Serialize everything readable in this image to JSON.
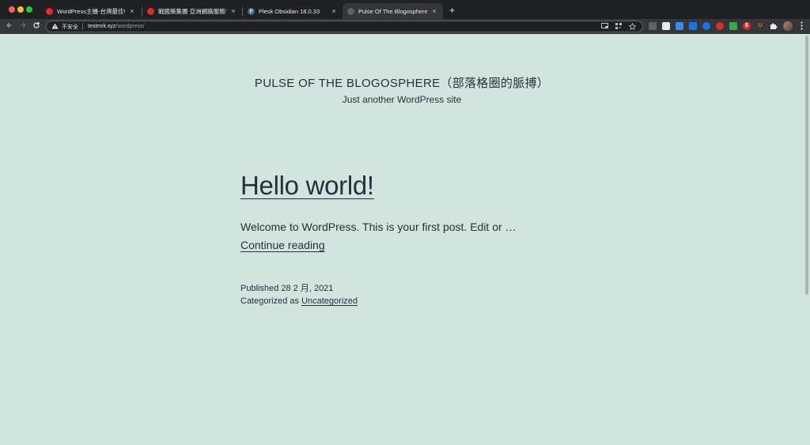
{
  "browser": {
    "tabs": [
      {
        "title": "WordPress主機-台灣最佳WordPress",
        "favicon_color": "#d93025"
      },
      {
        "title": "戰國策集團 亞洲網路服務領導品牌",
        "favicon_color": "#d93025"
      },
      {
        "title": "Plesk Obsidian 18.0.33",
        "favicon_color": "#3c6e91",
        "favicon_glyph": "p"
      },
      {
        "title": "Pulse Of The Blogosphere（部落",
        "favicon_color": "#5f6368",
        "active": true
      }
    ],
    "close_glyph": "×",
    "new_tab_glyph": "+",
    "url": {
      "security_label": "不安全",
      "host": "testmrk.xyz",
      "path": "/wordpress/"
    },
    "extension_colors": [
      "#9aa0a6",
      "#e8eaed",
      "#4285f4",
      "#1a73e8",
      "#1a73e8",
      "#d93025",
      "#34a853",
      "#d93025",
      "#f97316",
      "#e8eaed"
    ],
    "extension_glyphs": [
      "",
      "",
      "",
      "",
      "",
      "",
      "",
      "$",
      "U",
      ""
    ]
  },
  "site": {
    "title": "PULSE OF THE BLOGOSPHERE（部落格圈的脈搏）",
    "description": "Just another WordPress site"
  },
  "post": {
    "title": "Hello world!",
    "excerpt": "Welcome to WordPress. This is your first post. Edit or …",
    "continue_label": "Continue reading",
    "published_label": "Published 28 2 月, 2021",
    "categorized_prefix": "Categorized as",
    "category": "Uncategorized"
  },
  "colors": {
    "page_background": "#d1e4dd",
    "text": "#28303d"
  }
}
